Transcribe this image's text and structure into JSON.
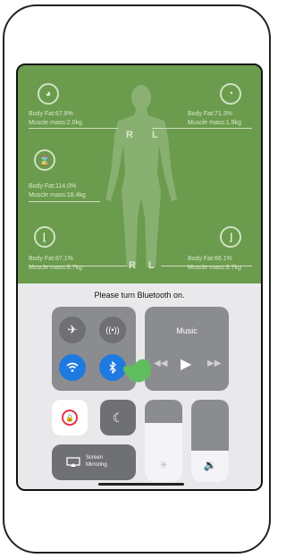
{
  "metrics": {
    "left_arm": {
      "fat": "Body Fat:67.8%",
      "muscle": "Muscle mass:2.0kg"
    },
    "right_arm": {
      "fat": "Body Fat:71.3%",
      "muscle": "Muscle mass:1.9kg"
    },
    "trunk": {
      "fat": "Body Fat:114.0%",
      "muscle": "Muscle mass:18.4kg"
    },
    "left_leg": {
      "fat": "Body Fat:87.1%",
      "muscle": "Muscle mass:6.7kg"
    },
    "right_leg": {
      "fat": "Body Fat:66.1%",
      "muscle": "Muscle mass:6.7kg"
    }
  },
  "body_labels": {
    "upper_r": "R",
    "upper_l": "L",
    "lower_r": "R",
    "lower_l": "L"
  },
  "control_center": {
    "bluetooth_notice": "Please turn Bluetooth on.",
    "music": {
      "title": "Music"
    },
    "screen_mirroring": {
      "line1": "Screen",
      "line2": "Mirroring"
    },
    "brightness_level": 0.72,
    "volume_level": 0.38
  },
  "colors": {
    "green_background": "#6b9b4d",
    "control_center_bg": "#e9e9ec",
    "tile_gray": "#8b8c90",
    "active_blue": "#1f7ae0",
    "orientation_lock_red": "#e5304a",
    "finger_green": "#5fbd5f"
  },
  "icons": [
    "airplane-icon",
    "cellular-icon",
    "wifi-icon",
    "bluetooth-icon",
    "rewind-icon",
    "play-icon",
    "forward-icon",
    "orientation-lock-icon",
    "moon-icon",
    "brightness-icon",
    "volume-icon",
    "screen-mirroring-icon",
    "tap-gesture-icon"
  ]
}
